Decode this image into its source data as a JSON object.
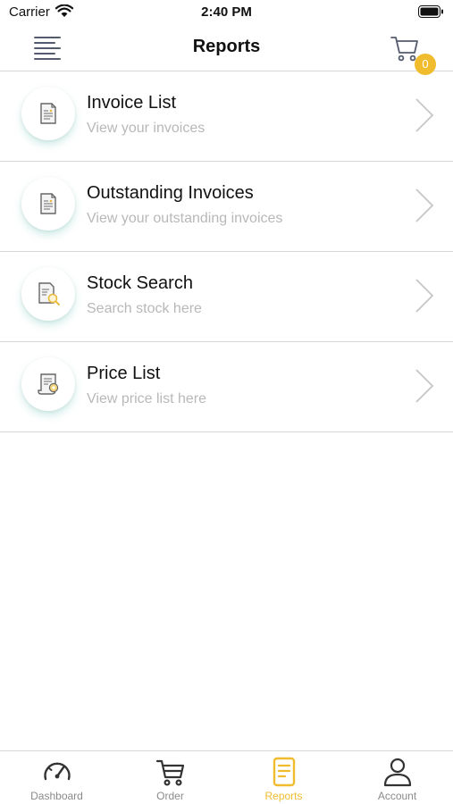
{
  "status_bar": {
    "carrier": "Carrier",
    "time": "2:40 PM"
  },
  "nav": {
    "title": "Reports",
    "cart_count": "0"
  },
  "reports": [
    {
      "title": "Invoice List",
      "subtitle": "View your invoices",
      "icon": "invoice-icon"
    },
    {
      "title": "Outstanding Invoices",
      "subtitle": "View your outstanding invoices",
      "icon": "invoice-icon"
    },
    {
      "title": "Stock Search",
      "subtitle": "Search stock here",
      "icon": "stock-search-icon"
    },
    {
      "title": "Price List",
      "subtitle": "View price list here",
      "icon": "price-list-icon"
    }
  ],
  "tabs": [
    {
      "label": "Dashboard",
      "icon": "speedometer-icon",
      "active": false
    },
    {
      "label": "Order",
      "icon": "cart-icon",
      "active": false
    },
    {
      "label": "Reports",
      "icon": "report-icon",
      "active": true
    },
    {
      "label": "Account",
      "icon": "user-icon",
      "active": false
    }
  ],
  "colors": {
    "accent": "#f0bc2d",
    "subtitle": "#b8b8b8",
    "divider": "#d8d8d8",
    "inactive_tab": "#8a8a8a"
  }
}
